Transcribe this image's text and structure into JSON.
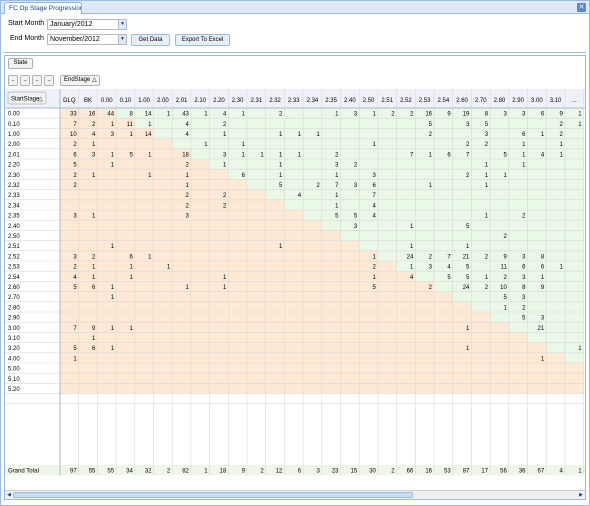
{
  "tab": {
    "title": "FC Op Stage Progression",
    "close_icon": "close-icon"
  },
  "form": {
    "start_label": "Start Month",
    "start_value": "January/2012",
    "end_label": "End Month",
    "end_value": "November/2012",
    "get_data": "Get Data",
    "export": "Export To Excel"
  },
  "pivot": {
    "state_button": "State",
    "collapse_buttons": [
      "..",
      "..",
      "..",
      ".."
    ],
    "col_field": "EndStage",
    "row_field": "StartStage",
    "sort_icon": "sort-asc-icon",
    "col_headers": [
      "DLQ",
      "BK",
      "0.00",
      "0.10",
      "1.00",
      "2.00",
      "2.01",
      "2.10",
      "2.20",
      "2.30",
      "2.31",
      "2.32",
      "2.33",
      "2.34",
      "2.35",
      "2.40",
      "2.50",
      "2.51",
      "2.52",
      "2.53",
      "2.54",
      "2.60",
      "2.70",
      "2.80",
      "2.90",
      "3.00",
      "3.10",
      "..."
    ],
    "row_headers": [
      "0.00",
      "0.10",
      "1.00",
      "2.00",
      "2.01",
      "2.20",
      "2.30",
      "2.32",
      "2.33",
      "2.34",
      "2.35",
      "2.40",
      "2.50",
      "2.51",
      "2.52",
      "2.53",
      "2.54",
      "2.60",
      "2.70",
      "2.80",
      "2.90",
      "3.00",
      "3.10",
      "3.20",
      "4.00",
      "5.00",
      "5.10",
      "5.20"
    ],
    "cells": [
      [
        "33",
        "16",
        "44",
        "8",
        "14",
        "1",
        "43",
        "1",
        "4",
        "1",
        "",
        "2",
        "",
        "",
        "1",
        "3",
        "1",
        "2",
        "2",
        "16",
        "9",
        "19",
        "8",
        "3",
        "3",
        "6",
        "9",
        "1"
      ],
      [
        "7",
        "2",
        "1",
        "11",
        "1",
        "",
        "4",
        "",
        "2",
        "",
        "",
        "",
        "",
        "",
        "",
        "",
        "",
        "",
        "",
        "5",
        "",
        "3",
        "5",
        "",
        "",
        "",
        "2",
        "1"
      ],
      [
        "10",
        "4",
        "3",
        "1",
        "14",
        "",
        "4",
        "",
        "1",
        "",
        "",
        "1",
        "1",
        "1",
        "",
        "",
        "",
        "",
        "",
        "2",
        "",
        "",
        "3",
        "",
        "6",
        "1",
        "2",
        ""
      ],
      [
        "2",
        "1",
        "",
        "",
        "",
        "",
        "",
        "1",
        "",
        "1",
        "",
        "",
        "",
        "",
        "",
        "",
        "1",
        "",
        "",
        "",
        "",
        "2",
        "2",
        "",
        "1",
        "",
        "1",
        ""
      ],
      [
        "6",
        "3",
        "1",
        "5",
        "1",
        "",
        "18",
        "",
        "3",
        "1",
        "1",
        "1",
        "1",
        "",
        "2",
        "",
        "",
        "",
        "7",
        "1",
        "6",
        "7",
        "",
        "5",
        "1",
        "4",
        "1",
        ""
      ],
      [
        "5",
        "",
        "1",
        "",
        "",
        "",
        "2",
        "",
        "1",
        "",
        "",
        "1",
        "",
        "",
        "3",
        "2",
        "",
        "",
        "",
        "",
        "",
        "",
        "1",
        "",
        "1",
        "",
        "",
        ""
      ],
      [
        "2",
        "1",
        "",
        "",
        "1",
        "",
        "1",
        "",
        "",
        "6",
        "",
        "1",
        "",
        "",
        "1",
        "",
        "3",
        "",
        "",
        "",
        "",
        "2",
        "1",
        "1",
        "",
        "",
        "",
        ""
      ],
      [
        "2",
        "",
        "",
        "",
        "",
        "",
        "1",
        "",
        "",
        "",
        "",
        "5",
        "",
        "2",
        "7",
        "3",
        "6",
        "",
        "",
        "1",
        "",
        "",
        "1",
        "",
        "",
        "",
        "",
        ""
      ],
      [
        "",
        "",
        "",
        "",
        "",
        "",
        "2",
        "",
        "2",
        "",
        "",
        "",
        "4",
        "",
        "1",
        "",
        "7",
        "",
        "",
        "",
        "",
        "",
        "",
        "",
        "",
        "",
        "",
        ""
      ],
      [
        "",
        "",
        "",
        "",
        "",
        "",
        "2",
        "",
        "2",
        "",
        "",
        "",
        "",
        "",
        "1",
        "",
        "4",
        "",
        "",
        "",
        "",
        "",
        "",
        "",
        "",
        "",
        "",
        ""
      ],
      [
        "3",
        "1",
        "",
        "",
        "",
        "",
        "3",
        "",
        "",
        "",
        "",
        "",
        "",
        "",
        "5",
        "5",
        "4",
        "",
        "",
        "",
        "",
        "",
        "1",
        "",
        "2",
        "",
        "",
        ""
      ],
      [
        "",
        "",
        "",
        "",
        "",
        "",
        "",
        "",
        "",
        "",
        "",
        "",
        "",
        "",
        "",
        "3",
        "",
        "",
        "1",
        "",
        "",
        "5",
        "",
        "",
        "",
        "",
        "",
        ""
      ],
      [
        "",
        "",
        "",
        "",
        "",
        "",
        "",
        "",
        "",
        "",
        "",
        "",
        "",
        "",
        "",
        "",
        "",
        "",
        "",
        "",
        "",
        "",
        "",
        "2",
        "",
        "",
        "",
        ""
      ],
      [
        "",
        "",
        "1",
        "",
        "",
        "",
        "",
        "",
        "",
        "",
        "",
        "1",
        "",
        "",
        "",
        "",
        "",
        "",
        "1",
        "",
        "",
        "1",
        "",
        "",
        "",
        "",
        "",
        ""
      ],
      [
        "3",
        "2",
        "",
        "6",
        "1",
        "",
        "",
        "",
        "",
        "",
        "",
        "",
        "",
        "",
        "",
        "",
        "1",
        "",
        "24",
        "2",
        "7",
        "21",
        "2",
        "9",
        "3",
        "8",
        "",
        ""
      ],
      [
        "2",
        "1",
        "",
        "1",
        "",
        "1",
        "",
        "",
        "",
        "",
        "",
        "",
        "",
        "",
        "",
        "",
        "2",
        "",
        "1",
        "3",
        "4",
        "5",
        "",
        "11",
        "6",
        "6",
        "1",
        ""
      ],
      [
        "4",
        "1",
        "",
        "1",
        "",
        "",
        "",
        "",
        "1",
        "",
        "",
        "",
        "",
        "",
        "",
        "",
        "1",
        "",
        "4",
        "",
        "5",
        "5",
        "1",
        "2",
        "3",
        "1",
        "",
        ""
      ],
      [
        "5",
        "6",
        "1",
        "",
        "",
        "",
        "1",
        "",
        "1",
        "",
        "",
        "",
        "",
        "",
        "",
        "",
        "5",
        "",
        "",
        "2",
        "",
        "24",
        "2",
        "10",
        "8",
        "9",
        "",
        ""
      ],
      [
        "",
        "",
        "1",
        "",
        "",
        "",
        "",
        "",
        "",
        "",
        "",
        "",
        "",
        "",
        "",
        "",
        "",
        "",
        "",
        "",
        "",
        "",
        "",
        "5",
        "3",
        "",
        "",
        ""
      ],
      [
        "",
        "",
        "",
        "",
        "",
        "",
        "",
        "",
        "",
        "",
        "",
        "",
        "",
        "",
        "",
        "",
        "",
        "",
        "",
        "",
        "",
        "",
        "",
        "1",
        "2",
        "",
        "",
        ""
      ],
      [
        "",
        "",
        "",
        "",
        "",
        "",
        "",
        "",
        "",
        "",
        "",
        "",
        "",
        "",
        "",
        "",
        "",
        "",
        "",
        "",
        "",
        "",
        "",
        "",
        "5",
        "3",
        "",
        ""
      ],
      [
        "7",
        "9",
        "1",
        "1",
        "",
        "",
        "",
        "",
        "",
        "",
        "",
        "",
        "",
        "",
        "",
        "",
        "",
        "",
        "",
        "",
        "",
        "1",
        "",
        "",
        "",
        "21",
        "",
        ""
      ],
      [
        "",
        "1",
        "",
        "",
        "",
        "",
        "",
        "",
        "",
        "",
        "",
        "",
        "",
        "",
        "",
        "",
        "",
        "",
        "",
        "",
        "",
        "",
        "",
        "",
        "",
        "",
        "",
        ""
      ],
      [
        "5",
        "6",
        "1",
        "",
        "",
        "",
        "",
        "",
        "",
        "",
        "",
        "",
        "",
        "",
        "",
        "",
        "",
        "",
        "",
        "",
        "",
        "1",
        "",
        "",
        "",
        "",
        "",
        "1"
      ],
      [
        "1",
        "",
        "",
        "",
        "",
        "",
        "",
        "",
        "",
        "",
        "",
        "",
        "",
        "",
        "",
        "",
        "",
        "",
        "",
        "",
        "",
        "",
        "",
        "",
        "",
        "1",
        "",
        ""
      ],
      [
        "",
        "",
        "",
        "",
        "",
        "",
        "",
        "",
        "",
        "",
        "",
        "",
        "",
        "",
        "",
        "",
        "",
        "",
        "",
        "",
        "",
        "",
        "",
        "",
        "",
        "",
        "",
        ""
      ],
      [
        "",
        "",
        "",
        "",
        "",
        "",
        "",
        "",
        "",
        "",
        "",
        "",
        "",
        "",
        "",
        "",
        "",
        "",
        "",
        "",
        "",
        "",
        "",
        "",
        "",
        "",
        "",
        ""
      ],
      [
        "",
        "",
        "",
        "",
        "",
        "",
        "",
        "",
        "",
        "",
        "",
        "",
        "",
        "",
        "",
        "",
        "",
        "",
        "",
        "",
        "",
        "",
        "",
        "",
        "",
        "",
        "",
        ""
      ]
    ],
    "grand_total_label": "Grand Total",
    "grand_totals": [
      "97",
      "55",
      "55",
      "34",
      "32",
      "2",
      "82",
      "1",
      "18",
      "9",
      "2",
      "12",
      "6",
      "3",
      "23",
      "15",
      "30",
      "2",
      "66",
      "16",
      "53",
      "87",
      "17",
      "56",
      "36",
      "67",
      "4",
      "1"
    ],
    "colors": {
      "peach": "#fde9d4",
      "green": "#eaf8e8",
      "header": "#eef2f8",
      "grid": "#d9d9d9"
    }
  }
}
